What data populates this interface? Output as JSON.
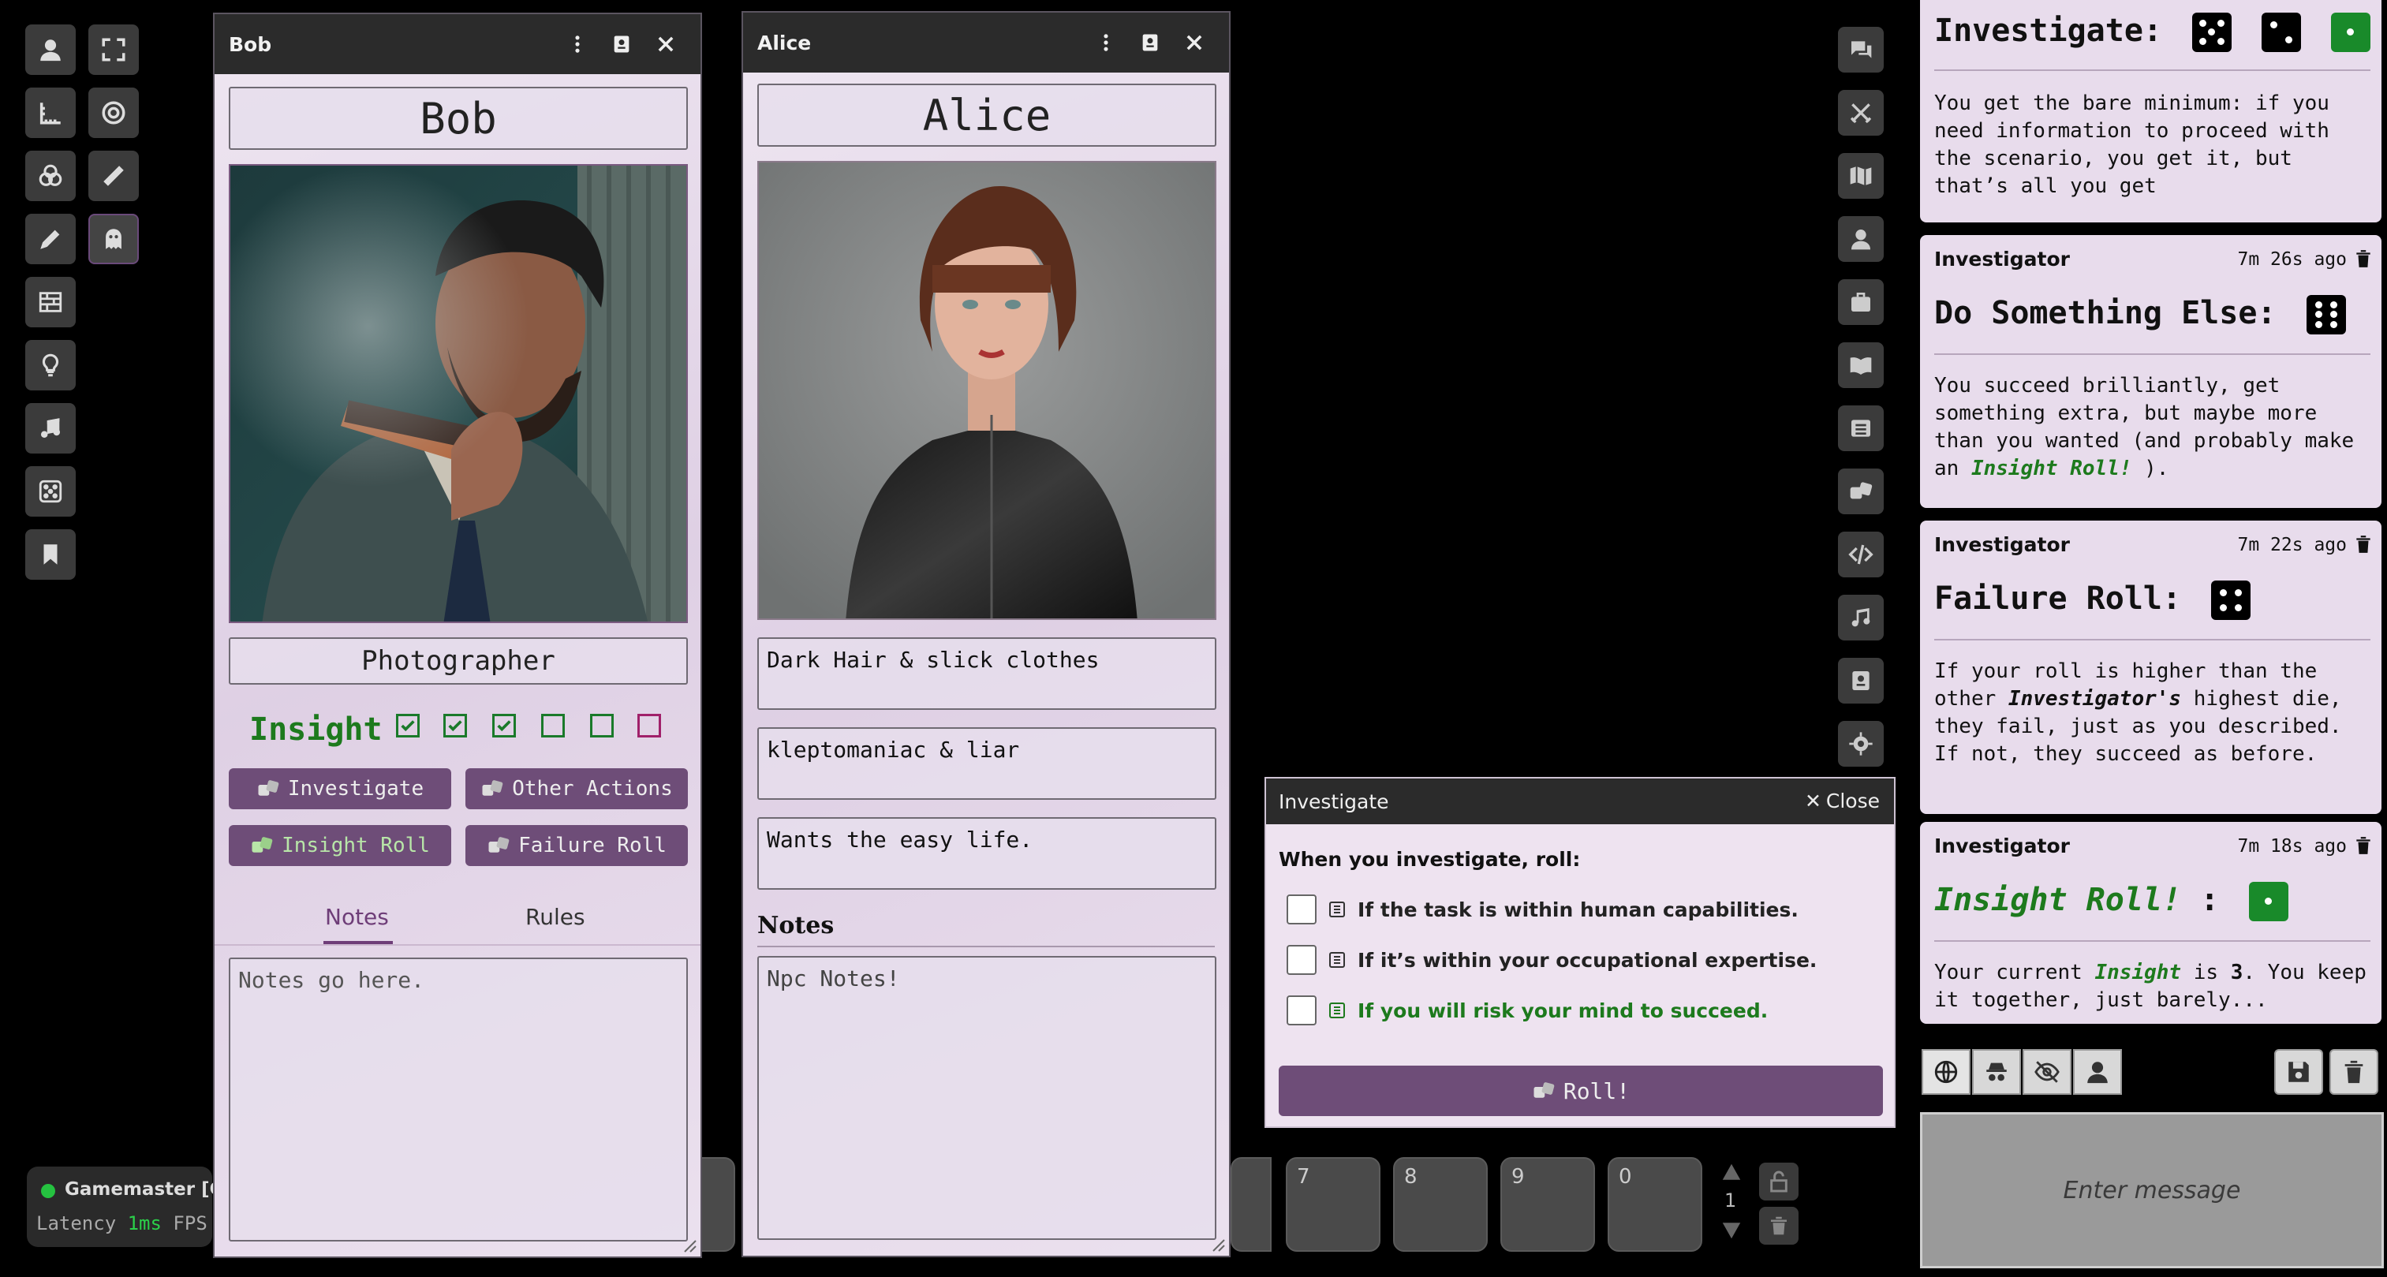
{
  "bob": {
    "window_title": "Bob",
    "name": "Bob",
    "occupation": "Photographer",
    "stat_label": "Insight",
    "insight_checks": [
      true,
      true,
      true,
      false,
      false,
      false
    ],
    "buttons": [
      "Investigate",
      "Other Actions",
      "Insight Roll",
      "Failure Roll"
    ],
    "tabs": [
      "Notes",
      "Rules"
    ],
    "active_tab": "Notes",
    "notes_placeholder": "Notes go here."
  },
  "alice": {
    "window_title": "Alice",
    "name": "Alice",
    "fields": [
      "Dark Hair & slick clothes",
      "kleptomaniac & liar",
      "Wants the easy life."
    ],
    "notes_heading": "Notes",
    "notes_value": "Npc Notes!"
  },
  "hotbar": {
    "slots": [
      "7",
      "8",
      "9",
      "0"
    ],
    "page": "1"
  },
  "status": {
    "user": "Gamemaster [GM]",
    "latency_label": "Latency",
    "latency_value": "1ms",
    "fps_label": "FPS"
  },
  "dialog": {
    "title": "Investigate",
    "close_label": "Close",
    "prompt": "When you investigate, roll:",
    "options": [
      "If the task is within human capabilities.",
      "If it’s within your occupational expertise.",
      "If you will risk your mind to succeed."
    ],
    "roll_label": "Roll!"
  },
  "chat": {
    "messages": [
      {
        "author": "",
        "time": "",
        "title": "Investigate:",
        "dice": [
          5,
          2,
          1
        ],
        "body": "You get the bare minimum: if you need information to proceed with the scenario, you get it, but that’s all you get"
      },
      {
        "author": "Investigator",
        "time": "7m 26s ago",
        "title": "Do Something Else:",
        "dice": [
          6
        ],
        "body_parts": [
          "You succeed brilliantly, get something extra, but maybe more than you wanted (and probably make an ",
          "Insight Roll!",
          " )."
        ]
      },
      {
        "author": "Investigator",
        "time": "7m 22s ago",
        "title": "Failure Roll:",
        "dice": [
          4
        ],
        "body_parts": [
          "If your roll is higher than the other ",
          "Investigator's",
          " highest die, they fail, just as you described. If not, they succeed as before."
        ]
      },
      {
        "author": "Investigator",
        "time": "7m 18s ago",
        "title": "Insight Roll!",
        "title_suffix": " :",
        "dice": [
          1
        ],
        "body_parts": [
          "Your current ",
          "Insight",
          " is ",
          "3",
          ". You keep it together, just barely..."
        ]
      }
    ],
    "input_placeholder": "Enter message"
  },
  "colors": {
    "accent_purple": "#6e4d78",
    "insight_green": "#1d7a1d",
    "sheet_bg": "#e6d9ea",
    "titlebar": "#2b2b2b"
  },
  "icons": {
    "left_toolbar": [
      "user-icon",
      "fullscreen-icon",
      "ruler-icon",
      "target-icon",
      "dice-cluster-icon",
      "measure-icon",
      "pencil-icon",
      "ghost-icon",
      "wall-icon",
      "lightbulb-icon",
      "music-icon",
      "grid-dice-icon",
      "bookmark-icon"
    ],
    "right_toolbar": [
      "chat-icon",
      "swords-icon",
      "map-icon",
      "person-icon",
      "briefcase-icon",
      "book-icon",
      "list-icon",
      "dice-icon",
      "code-icon",
      "music-icon",
      "journal-icon",
      "gear-icon"
    ]
  }
}
